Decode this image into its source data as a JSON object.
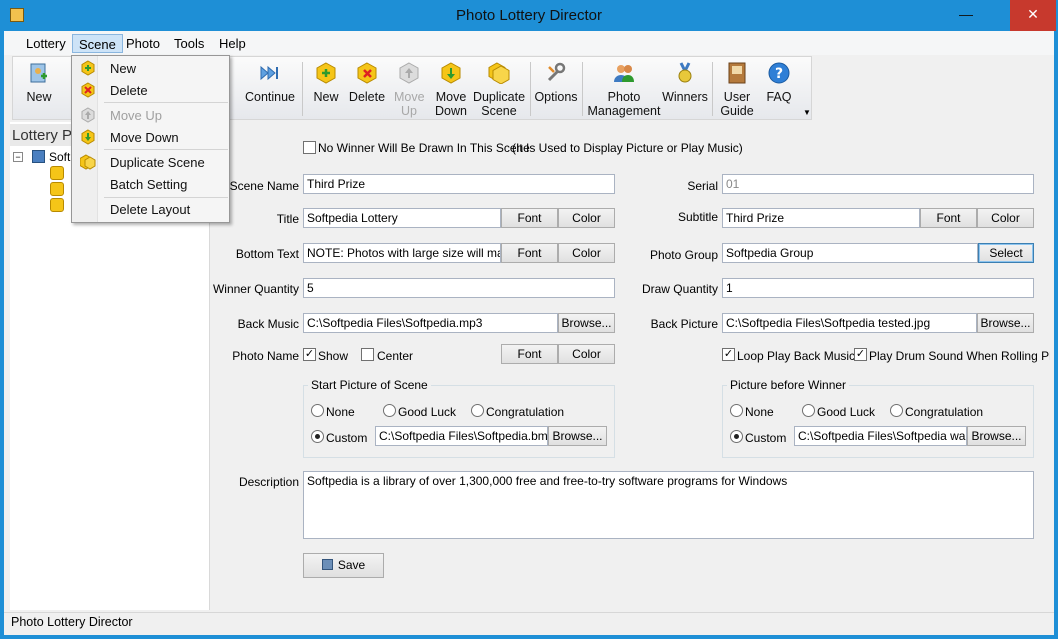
{
  "window": {
    "title": "Photo Lottery Director",
    "minimize": "—",
    "close": "✕"
  },
  "menubar": [
    "Lottery",
    "Scene",
    "Photo",
    "Tools",
    "Help"
  ],
  "toolbar": {
    "lottery_new": "New",
    "continue": "Continue",
    "scene_new": "New",
    "scene_delete": "Delete",
    "move_up": [
      "Move",
      "Up"
    ],
    "move_down": [
      "Move",
      "Down"
    ],
    "duplicate_scene": [
      "Duplicate",
      "Scene"
    ],
    "options": "Options",
    "photo_management": [
      "Photo",
      "Management"
    ],
    "winners": "Winners",
    "user_guide": [
      "User",
      "Guide"
    ],
    "faq": "FAQ"
  },
  "scene_menu": {
    "new": "New",
    "delete": "Delete",
    "move_up": "Move Up",
    "move_down": "Move Down",
    "duplicate_scene": "Duplicate Scene",
    "batch_setting": "Batch Setting",
    "delete_layout": "Delete Layout"
  },
  "tree": {
    "header": "Lottery P",
    "root": "Softpedia"
  },
  "form": {
    "no_winner_label": "No Winner Will Be Drawn In This Scene",
    "no_winner_note": "(It Is Used to Display Picture or Play Music)",
    "scene_name_label": "Scene Name",
    "scene_name": "Third Prize",
    "serial_label": "Serial",
    "serial": "01",
    "title_label": "Title",
    "title": "Softpedia Lottery",
    "subtitle_label": "Subtitle",
    "subtitle": "Third Prize",
    "bottom_text_label": "Bottom Text",
    "bottom_text": "NOTE: Photos with large size will make p",
    "photo_group_label": "Photo Group",
    "photo_group": "Softpedia Group",
    "winner_qty_label": "Winner Quantity",
    "winner_qty": "5",
    "draw_qty_label": "Draw Quantity",
    "draw_qty": "1",
    "back_music_label": "Back Music",
    "back_music": "C:\\Softpedia Files\\Softpedia.mp3",
    "back_picture_label": "Back Picture",
    "back_picture": "C:\\Softpedia Files\\Softpedia tested.jpg",
    "photo_name_label": "Photo Name",
    "show_label": "Show",
    "center_label": "Center",
    "loop_music_label": "Loop Play Back Music",
    "drum_sound_label": "Play Drum Sound When Rolling Photos",
    "start_picture_title": "Start Picture of Scene",
    "picture_before_title": "Picture before Winner",
    "none": "None",
    "good_luck": "Good Luck",
    "congratulation": "Congratulation",
    "custom": "Custom",
    "start_custom_path": "C:\\Softpedia Files\\Softpedia.bmp",
    "before_custom_path": "C:\\Softpedia Files\\Softpedia wallpap",
    "description_label": "Description",
    "description": "Softpedia is a library of over 1,300,000 free and free-to-try software programs for Windows",
    "font": "Font",
    "color": "Color",
    "browse": "Browse...",
    "select": "Select",
    "save": "Save"
  },
  "statusbar": {
    "text": "Photo Lottery Director"
  }
}
